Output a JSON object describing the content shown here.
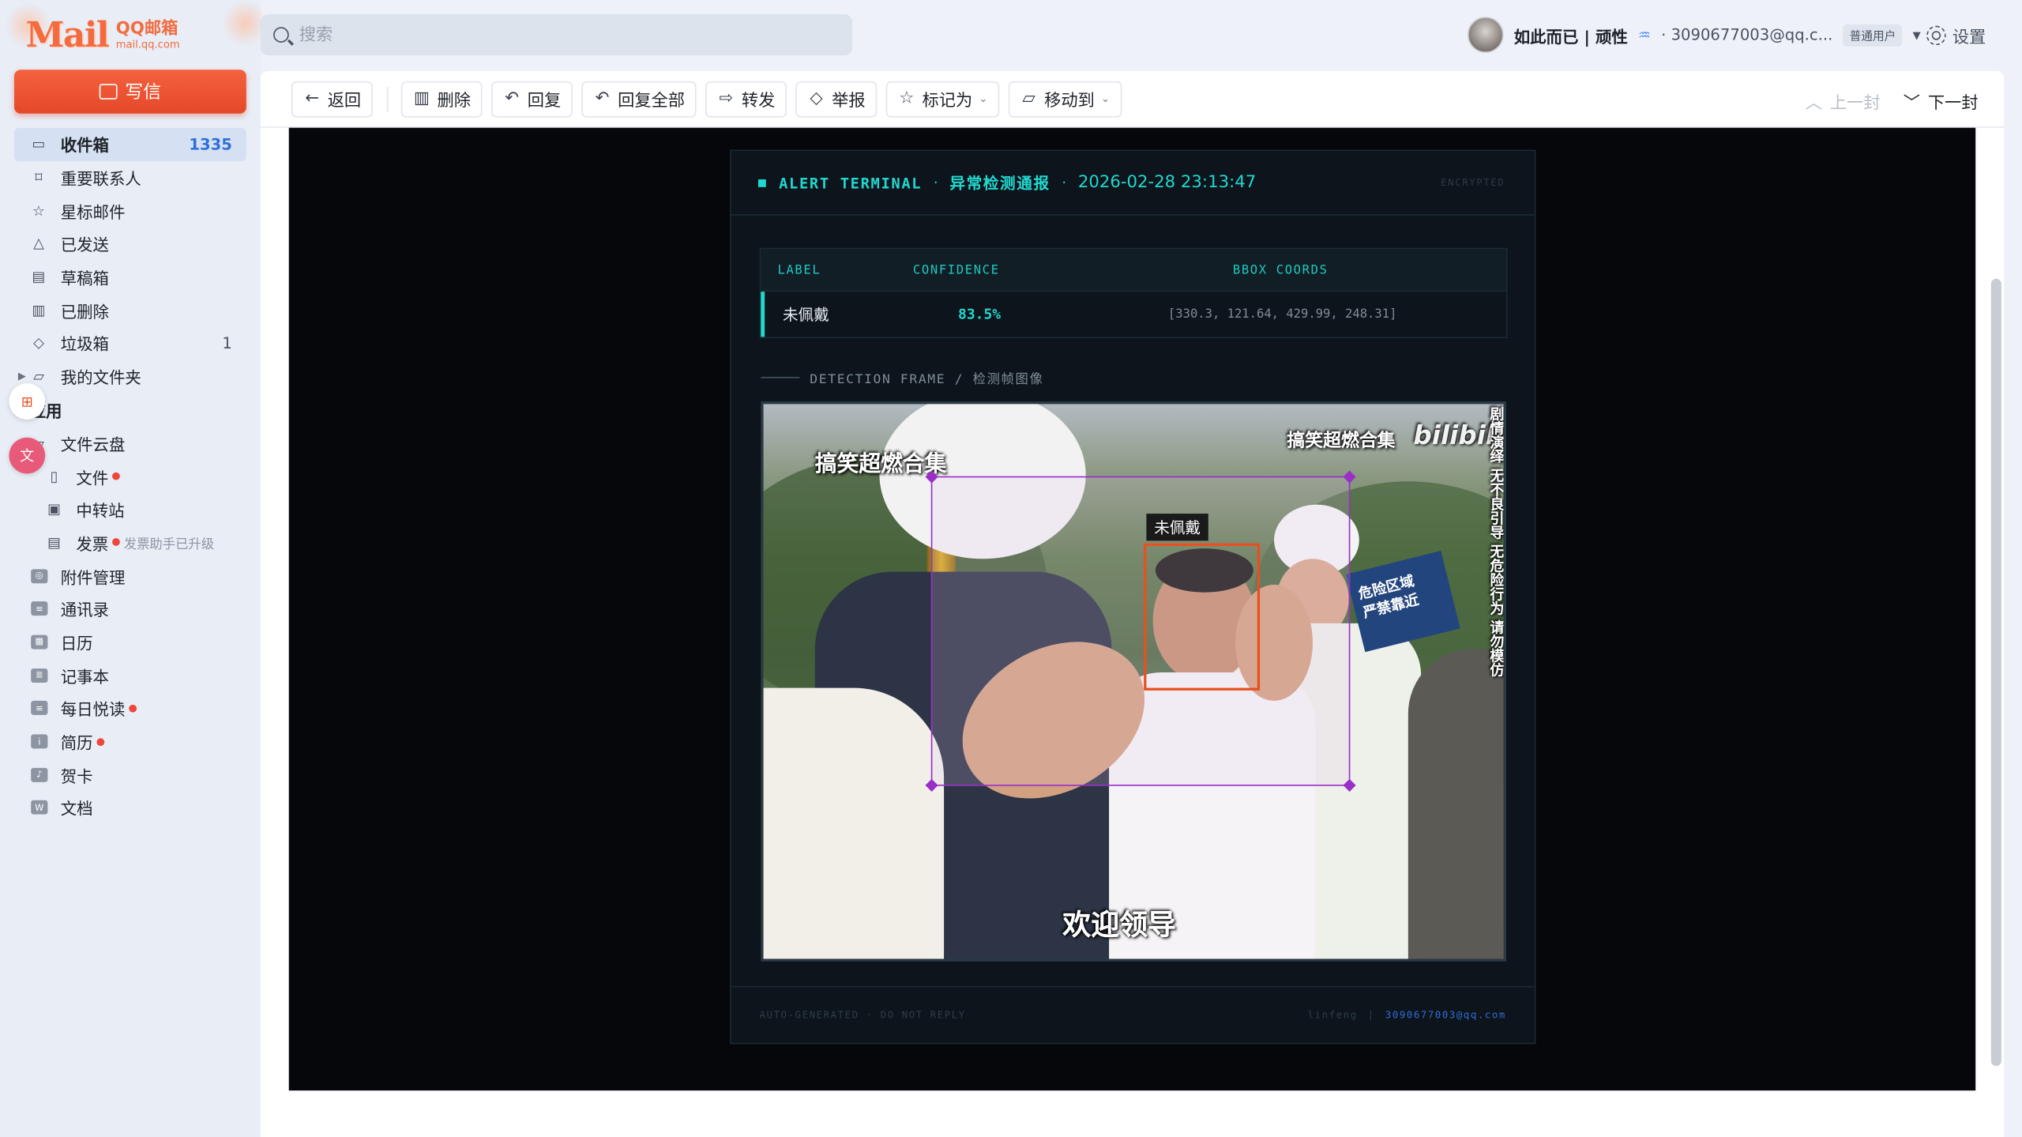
{
  "brand": {
    "logo_big": "Mail",
    "logo_cn": "QQ邮箱",
    "logo_domain": "mail.qq.com"
  },
  "compose_label": "写信",
  "nav": {
    "items": [
      {
        "label": "收件箱",
        "count": "1335",
        "icon": "inbox-icon"
      },
      {
        "label": "重要联系人",
        "count": "",
        "icon": "bookmark-icon"
      },
      {
        "label": "星标邮件",
        "count": "",
        "icon": "star-icon"
      },
      {
        "label": "已发送",
        "count": "",
        "icon": "send-icon"
      },
      {
        "label": "草稿箱",
        "count": "",
        "icon": "draft-icon"
      },
      {
        "label": "已删除",
        "count": "",
        "icon": "trash-icon"
      },
      {
        "label": "垃圾箱",
        "count": "1",
        "icon": "shield-icon"
      },
      {
        "label": "我的文件夹",
        "count": "",
        "icon": "folder-icon"
      }
    ],
    "apps_title": "应用",
    "cloud": {
      "label": "文件云盘",
      "sub": [
        {
          "label": "文件"
        },
        {
          "label": "中转站"
        },
        {
          "label": "发票",
          "hint": "发票助手已升级"
        }
      ]
    },
    "apps": [
      {
        "label": "附件管理"
      },
      {
        "label": "通讯录"
      },
      {
        "label": "日历"
      },
      {
        "label": "记事本"
      },
      {
        "label": "每日悦读"
      },
      {
        "label": "简历"
      },
      {
        "label": "贺卡"
      },
      {
        "label": "文档"
      }
    ]
  },
  "search": {
    "placeholder": "搜索"
  },
  "user": {
    "name": "如此而已 | 顽性",
    "email": "· 3090677003@qq.c...",
    "badge": "普通用户"
  },
  "settings_label": "设置",
  "toolbar": {
    "back": "返回",
    "delete": "删除",
    "reply": "回复",
    "reply_all": "回复全部",
    "forward": "转发",
    "report": "举报",
    "mark_as": "标记为",
    "move_to": "移动到",
    "prev": "上一封",
    "next": "下一封"
  },
  "alert": {
    "title": "ALERT TERMINAL",
    "subtitle": "异常检测通报",
    "sep": "·",
    "timestamp": "2026-02-28 23:13:47",
    "encrypted": "ENCRYPTED",
    "table": {
      "headers": [
        "LABEL",
        "CONFIDENCE",
        "BBOX COORDS"
      ],
      "row": {
        "label": "未佩戴",
        "confidence": "83.5%",
        "bbox": "[330.3, 121.64, 429.99, 248.31]"
      }
    },
    "section_label": "DETECTION FRAME / 检测帧图像",
    "frame": {
      "overlay_left": "搞笑超燃合集",
      "overlay_right": "搞笑超燃合集",
      "watermark": "bilibili",
      "vertical_text": "剧情演绎 无不良引导 无危险行为 请勿模仿",
      "sign_text": "危险区域\n严禁靠近",
      "caption": "欢迎领导",
      "detection_tag": "未佩戴"
    },
    "footer": {
      "left": "AUTO-GENERATED · DO NOT REPLY",
      "sender": "linfeng",
      "pipe": "|",
      "email": "3090677003@qq.com"
    }
  },
  "colors": {
    "accent": "#21d8d0",
    "brand": "#f36b3f",
    "detection_box": "#9a2fc8",
    "face_box": "#e8501e"
  }
}
